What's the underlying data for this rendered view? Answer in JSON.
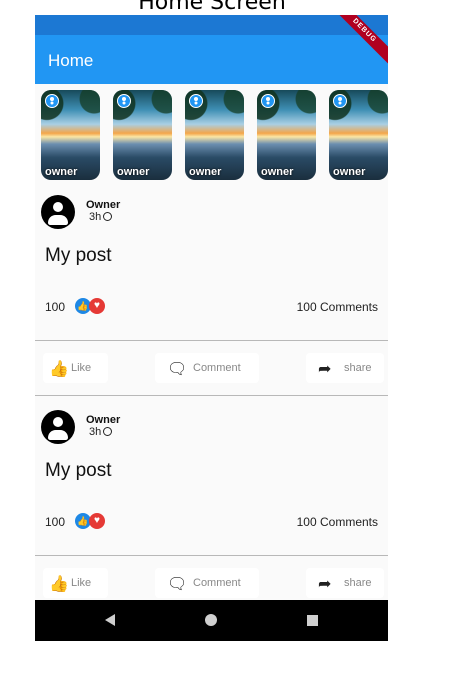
{
  "caption": "Home Screen",
  "debug_banner": "DEBUG",
  "appbar": {
    "title": "Home"
  },
  "stories": [
    {
      "name": "owner"
    },
    {
      "name": "owner"
    },
    {
      "name": "owner"
    },
    {
      "name": "owner"
    },
    {
      "name": "owner"
    }
  ],
  "posts": [
    {
      "author": "Owner",
      "time": "3h",
      "text": "My post",
      "reaction_count": "100",
      "comments": "100 Comments",
      "actions": {
        "like": "Like",
        "comment": "Comment",
        "share": "share"
      }
    },
    {
      "author": "Owner",
      "time": "3h",
      "text": "My post",
      "reaction_count": "100",
      "comments": "100 Comments",
      "actions": {
        "like": "Like",
        "comment": "Comment",
        "share": "share"
      }
    }
  ],
  "colors": {
    "appbar": "#2196f3",
    "status_bar": "#1c78d3",
    "like_reaction": "#1e88e5",
    "love_reaction": "#e53935",
    "nav_bar": "#000000"
  },
  "icons": {
    "like": "thumbs-up-icon",
    "comment": "speech-bubble-icon",
    "share": "share-arrow-icon",
    "privacy": "globe-icon",
    "avatar": "person-icon"
  }
}
